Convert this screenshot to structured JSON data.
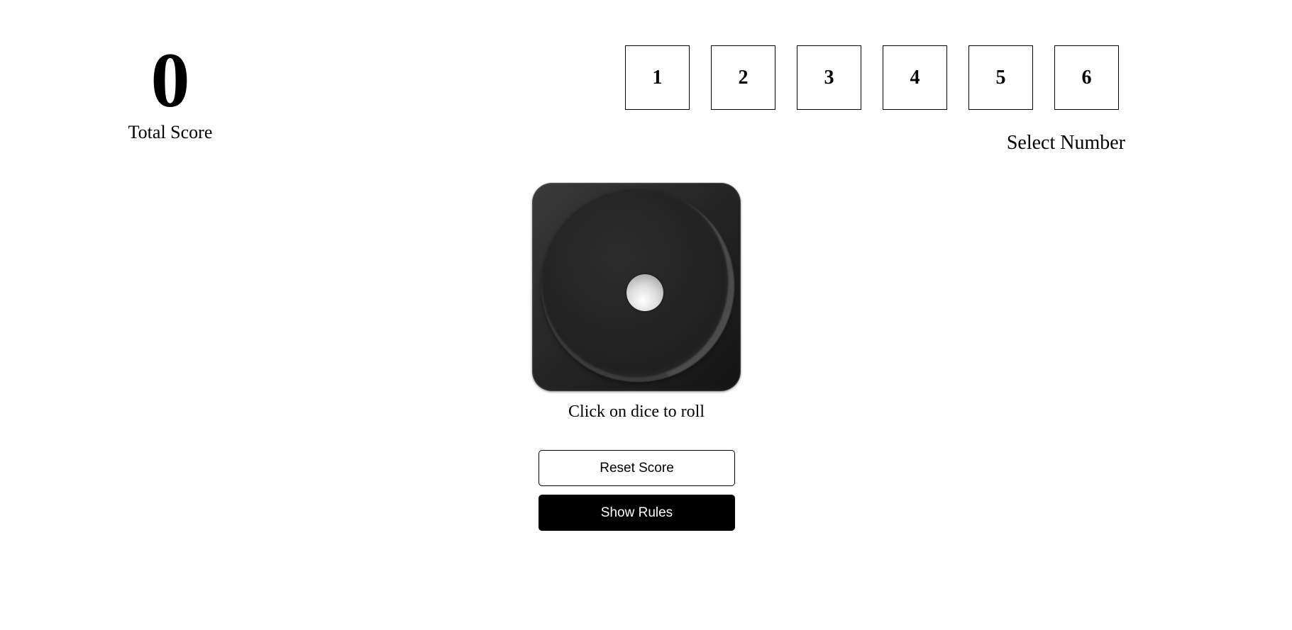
{
  "score": {
    "value": "0",
    "label": "Total Score"
  },
  "number_selector": {
    "options": [
      "1",
      "2",
      "3",
      "4",
      "5",
      "6"
    ],
    "label": "Select Number"
  },
  "dice": {
    "current_value": 1,
    "icon": "dice-one-icon",
    "hint": "Click on dice to roll"
  },
  "buttons": {
    "reset_label": "Reset Score",
    "rules_label": "Show Rules"
  },
  "colors": {
    "primary": "#000000",
    "background": "#ffffff"
  }
}
